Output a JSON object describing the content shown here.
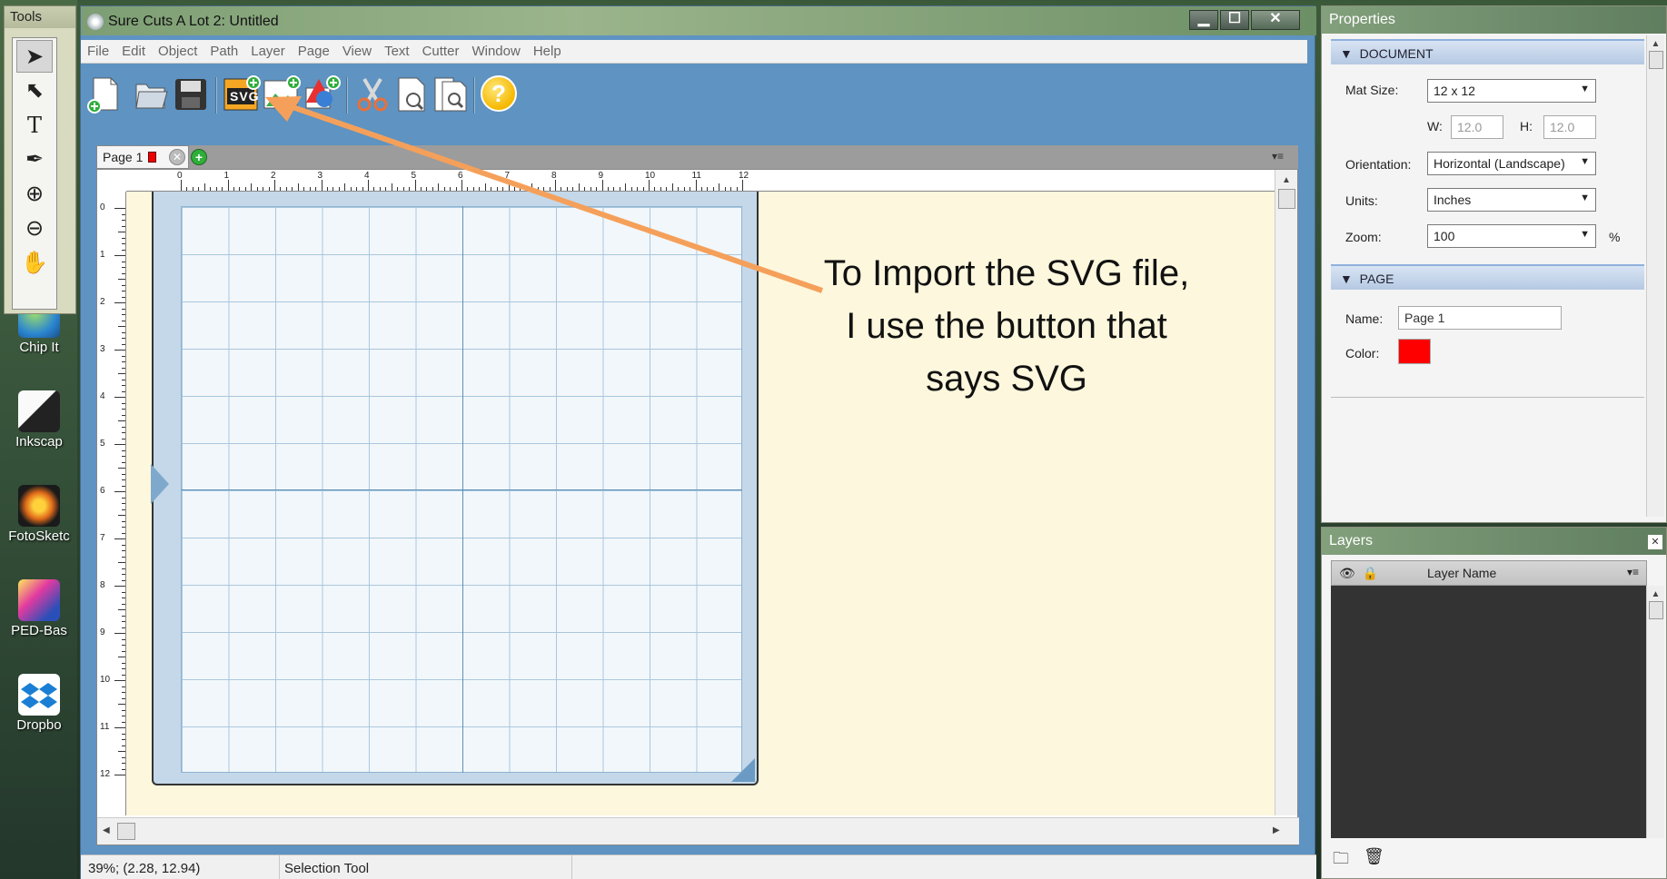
{
  "desktop": {
    "icons": [
      {
        "label": "Chip It",
        "color": "#3b8fd6",
        "icon": "globe-icon"
      },
      {
        "label": "Inkscap",
        "color": "#1e1e1e",
        "icon": "inkscape-icon"
      },
      {
        "label": "FotoSketc",
        "color": "#e06a1a",
        "icon": "fotosketcher-icon"
      },
      {
        "label": "PED-Bas",
        "color": "#2b4fb8",
        "icon": "ped-basic-icon"
      },
      {
        "label": "Dropbo",
        "color": "#1a7fd4",
        "icon": "dropbox-icon"
      }
    ]
  },
  "tools": {
    "title": "Tools",
    "items": [
      {
        "name": "selection-tool",
        "glyph": "➤"
      },
      {
        "name": "node-edit-tool",
        "glyph": "⬉"
      },
      {
        "name": "text-tool",
        "glyph": "T"
      },
      {
        "name": "pen-tool",
        "glyph": "✒"
      },
      {
        "name": "zoom-in-tool",
        "glyph": "⊕"
      },
      {
        "name": "zoom-out-tool",
        "glyph": "⊖"
      },
      {
        "name": "hand-tool",
        "glyph": "✋"
      }
    ]
  },
  "window": {
    "title": "Sure Cuts A Lot 2: Untitled",
    "controls": {
      "minimize": "▁",
      "maximize": "☐",
      "close": "✕"
    }
  },
  "menu": [
    "File",
    "Edit",
    "Object",
    "Path",
    "Layer",
    "Page",
    "View",
    "Text",
    "Cutter",
    "Window",
    "Help"
  ],
  "toolbar": {
    "svg_label": "SVG",
    "help_glyph": "?"
  },
  "page_tab": {
    "label": "Page 1",
    "color": "#ff0000"
  },
  "rulers": {
    "top": [
      "0",
      "1",
      "2",
      "3",
      "4",
      "5",
      "6",
      "7",
      "8",
      "9",
      "10",
      "11",
      "12"
    ],
    "left": [
      "0",
      "1",
      "2",
      "3",
      "4",
      "5",
      "6",
      "7",
      "8",
      "9",
      "10",
      "11",
      "12"
    ]
  },
  "annotation": {
    "line1": "To Import the SVG file,",
    "line2": "I use the button that",
    "line3": "says SVG"
  },
  "status": {
    "zoom_coords": "39%; (2.28, 12.94)",
    "tool": "Selection Tool"
  },
  "properties": {
    "title": "Properties",
    "document": {
      "header": "DOCUMENT",
      "mat_size_label": "Mat Size:",
      "mat_size": "12 x 12",
      "w_label": "W:",
      "w_value": "12.0",
      "h_label": "H:",
      "h_value": "12.0",
      "orientation_label": "Orientation:",
      "orientation": "Horizontal (Landscape)",
      "units_label": "Units:",
      "units": "Inches",
      "zoom_label": "Zoom:",
      "zoom": "100",
      "zoom_unit": "%"
    },
    "page": {
      "header": "PAGE",
      "name_label": "Name:",
      "name_value": "Page 1",
      "color_label": "Color:",
      "color": "#ff0000"
    }
  },
  "layers": {
    "title": "Layers",
    "column": "Layer Name"
  },
  "colors": {
    "accent_arrow": "#f5a05a",
    "canvas_bg": "#fdf7dd",
    "app_blue": "#5e93c2"
  }
}
